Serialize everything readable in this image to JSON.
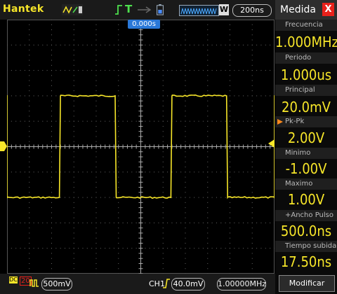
{
  "topbar": {
    "brand": "Hantek",
    "timebase": "200ns",
    "mem_mode": "W",
    "trigger_mode": "T"
  },
  "screen": {
    "trigger_position": "0.000s"
  },
  "bottombar": {
    "ch1_scale": "500mV",
    "trigger_source": "CH1",
    "trigger_level": "40.0mV",
    "frequency": "1.00000MHz",
    "coupling_indicator": "DC",
    "bw_indicator": "20"
  },
  "panel": {
    "title": "Medida",
    "close": "X",
    "measurements": [
      {
        "label": "Frecuencia",
        "value": "1.000MHz"
      },
      {
        "label": "Periodo",
        "value": "1.000us"
      },
      {
        "label": "Principal",
        "value": "20.0mV"
      },
      {
        "label": "Pk-Pk",
        "value": "2.00V"
      },
      {
        "label": "Minimo",
        "value": "-1.00V"
      },
      {
        "label": "Maximo",
        "value": "1.00V"
      },
      {
        "label": "+Ancho Pulso",
        "value": "500.0ns"
      },
      {
        "label": "Tiempo subida",
        "value": "17.50ns"
      }
    ],
    "modify_label": "Modificar"
  },
  "colors": {
    "trace": "#f7e629",
    "trigger_badge": "#2a78d8",
    "close": "#e8211b"
  },
  "waveform": {
    "type": "square",
    "high_v": 1.0,
    "low_v": -1.0,
    "period_us": 1.0,
    "duty": 0.5
  }
}
